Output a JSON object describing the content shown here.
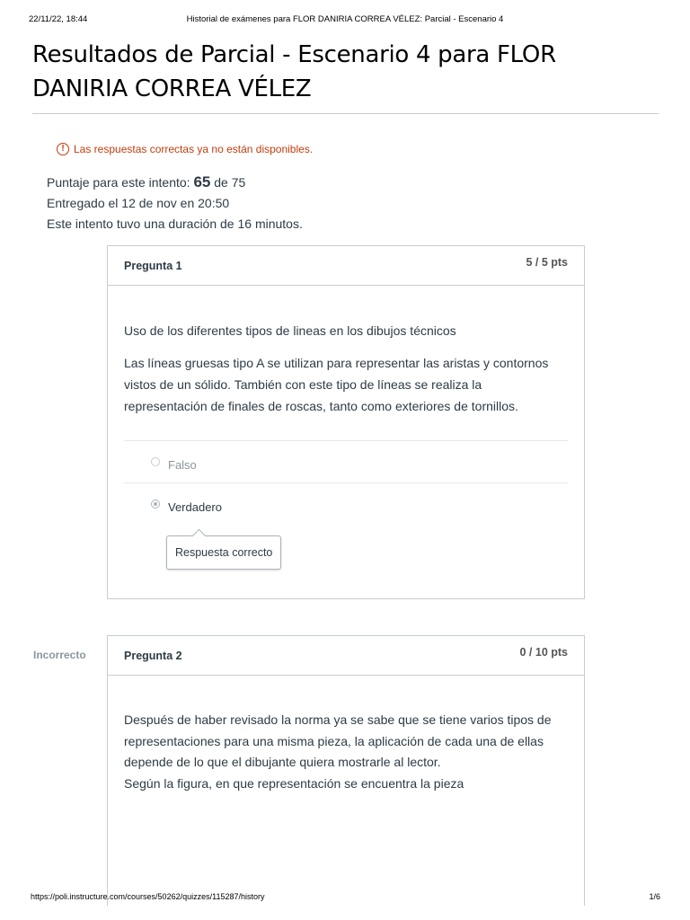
{
  "print": {
    "date": "22/11/22, 18:44",
    "doc_title": "Historial de exámenes para FLOR DANIRIA CORREA VÉLEZ: Parcial - Escenario 4",
    "url": "https://poli.instructure.com/courses/50262/quizzes/115287/history",
    "page": "1/6"
  },
  "page": {
    "title": "Resultados de Parcial - Escenario 4 para FLOR DANIRIA CORREA VÉLEZ"
  },
  "warning": {
    "icon": "exclamation-icon",
    "text": "Las respuestas correctas ya no están disponibles.",
    "color": "#c23c0d"
  },
  "summary": {
    "score_label": "Puntaje para este intento:",
    "score": "65",
    "score_of": "de 75",
    "submitted": "Entregado el 12 de nov en 20:50",
    "duration": "Este intento tuvo una duración de 16 minutos."
  },
  "questions": [
    {
      "name": "Pregunta 1",
      "points": "5 / 5 pts",
      "status": "",
      "title": "Uso de los diferentes tipos de lineas en los dibujos técnicos",
      "body": "Las líneas gruesas tipo A se utilizan para representar las aristas y contornos vistos de un sólido. También con este tipo de líneas se realiza la representación de finales de roscas, tanto como exteriores de tornillos.",
      "answers": [
        {
          "label": "Falso",
          "selected": false
        },
        {
          "label": "Verdadero",
          "selected": true
        }
      ],
      "feedback": "Respuesta correcto"
    },
    {
      "name": "Pregunta 2",
      "points": "0 / 10 pts",
      "status": "Incorrecto",
      "body_lines": [
        "Después de haber revisado la norma ya se sabe que se tiene varios tipos de representaciones para una misma pieza, la aplicación de cada una de ellas depende de lo que el dibujante quiera mostrarle al lector.",
        "Según la figura, en que representación se encuentra la pieza"
      ]
    }
  ]
}
